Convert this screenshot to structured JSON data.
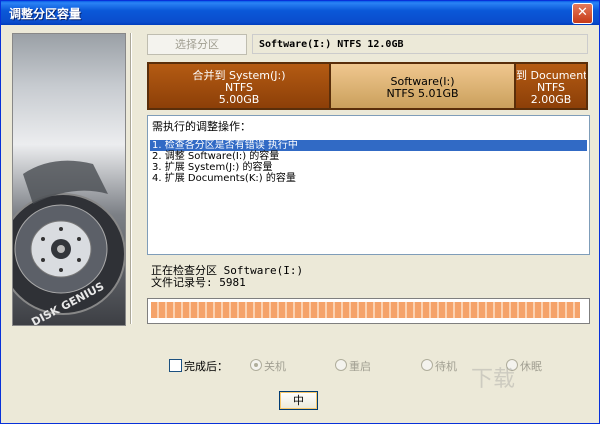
{
  "window": {
    "title": "调整分区容量",
    "close_symbol": "✕"
  },
  "header": {
    "select_partition_button": "选择分区",
    "partition_info": "Software(I:) NTFS 12.0GB"
  },
  "partitions": [
    {
      "name": "合并到 System(J:)",
      "fs": "NTFS",
      "size": "5.00GB",
      "selected": false
    },
    {
      "name": "Software(I:)",
      "fs": "NTFS",
      "size": "NTFS 5.01GB",
      "selected": true
    },
    {
      "name": "到 Document",
      "fs": "NTFS",
      "size": "2.00GB",
      "selected": false
    }
  ],
  "operations": {
    "title": "需执行的调整操作：",
    "items": [
      "1. 检查各分区是否有错误    执行中",
      "2. 调整 Software(I:) 的容量",
      "3. 扩展 System(J:) 的容量",
      "4. 扩展 Documents(K:) 的容量"
    ]
  },
  "status": {
    "line1": "正在检查分区 Software(I:)",
    "line2": "文件记录号: 5981"
  },
  "progress": {
    "fraction": 0.99
  },
  "after_done": {
    "label": "完成后：",
    "options": [
      "关机",
      "重启",
      "待机",
      "休眠"
    ],
    "selected": "关机"
  },
  "buttons": {
    "stop": "中"
  },
  "left_panel": {
    "brand": "DISK GENIUS"
  },
  "watermark": "下载"
}
